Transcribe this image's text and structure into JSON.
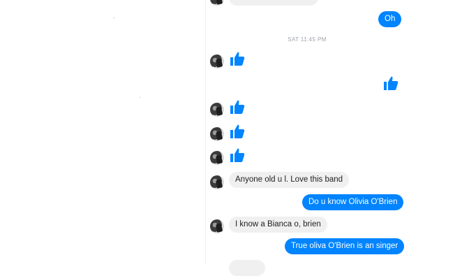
{
  "timestamp": "SAT 11:45 PM",
  "messages": {
    "m0": "Oh",
    "m1": "Anyone old u l. Love this band",
    "m2": "Do u know Olivia O'Brien",
    "m3": "I know a Bianca o, brien",
    "m4": "True oliva O'Brien is an singer"
  },
  "colors": {
    "accent": "#0084ff",
    "incoming_bubble": "#f1f0f0"
  },
  "icons": {
    "like": "thumbs-up-icon"
  }
}
